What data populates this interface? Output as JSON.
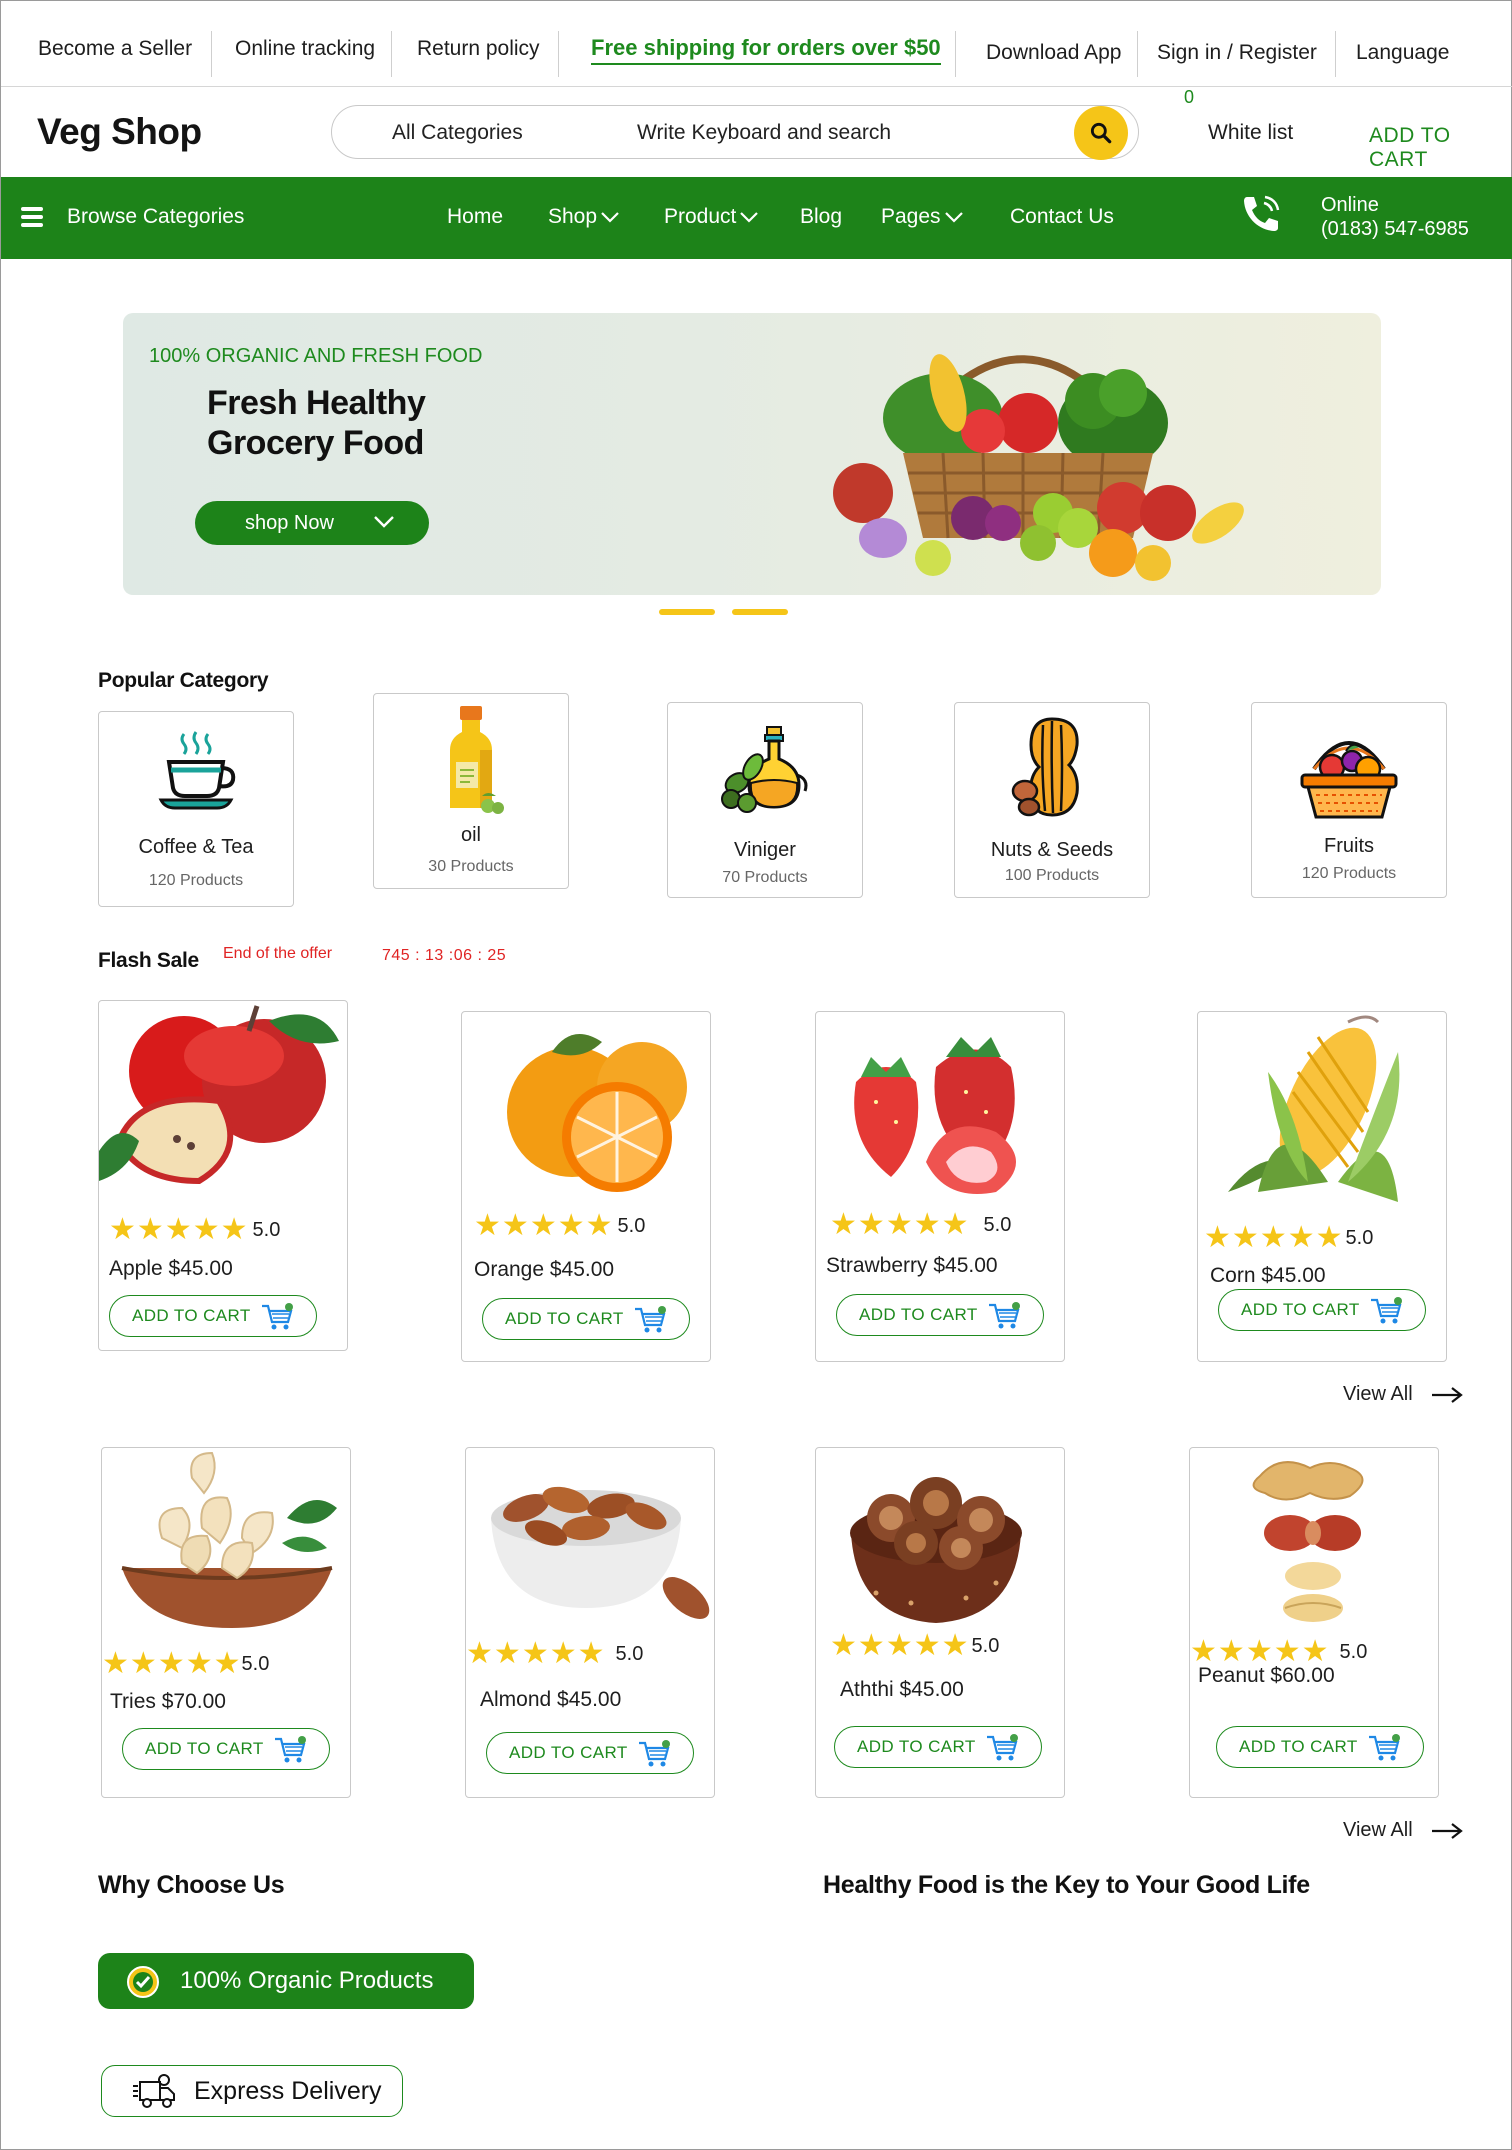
{
  "topbar": {
    "become_seller": "Become a Seller",
    "online_tracking": "Online tracking",
    "return_policy": "Return policy",
    "promo": "Free shipping for orders over $50",
    "download_app": "Download App",
    "sign_in": "Sign in / Register",
    "language": "Language"
  },
  "header": {
    "logo": "Veg Shop",
    "search_category": "All Categories",
    "search_placeholder": "Write Keyboard and search",
    "wishlist_count": "0",
    "wishlist": "White list",
    "add_to_cart": "ADD TO CART"
  },
  "nav": {
    "browse": "Browse Categories",
    "items": [
      "Home",
      "Shop",
      "Product",
      "Blog",
      "Pages",
      "Contact Us"
    ],
    "online_label": "Online",
    "phone": "(0183) 547-6985"
  },
  "hero": {
    "eyebrow": "100% ORGANIC AND FRESH FOOD",
    "title_line1": "Fresh Healthy",
    "title_line2": "Grocery Food",
    "button": "shop Now"
  },
  "popular": {
    "title": "Popular Category",
    "items": [
      {
        "name": "Coffee & Tea",
        "count": "120 Products"
      },
      {
        "name": "oil",
        "count": "30 Products"
      },
      {
        "name": "Viniger",
        "count": "70 Products"
      },
      {
        "name": "Nuts & Seeds",
        "count": "100 Products"
      },
      {
        "name": "Fruits",
        "count": "120 Products"
      }
    ]
  },
  "flash": {
    "title": "Flash Sale",
    "end_label": "End of the offer",
    "timer": "745 : 13 :06 : 25",
    "products": [
      {
        "name": "Apple $45.00",
        "rating": "5.0",
        "cta": "ADD TO CART"
      },
      {
        "name": "Orange $45.00",
        "rating": "5.0",
        "cta": "ADD TO CART"
      },
      {
        "name": "Strawberry $45.00",
        "rating": "5.0",
        "cta": "ADD TO CART"
      },
      {
        "name": "Corn $45.00",
        "rating": "5.0",
        "cta": "ADD TO CART"
      }
    ],
    "view_all": "View All"
  },
  "nuts": {
    "products": [
      {
        "name": "Tries $70.00",
        "rating": "5.0",
        "cta": "ADD TO CART"
      },
      {
        "name": "Almond $45.00",
        "rating": "5.0",
        "cta": "ADD TO CART"
      },
      {
        "name": "Aththi $45.00",
        "rating": "5.0",
        "cta": "ADD TO CART"
      },
      {
        "name": "Peanut $60.00",
        "rating": "5.0",
        "cta": "ADD TO CART"
      }
    ],
    "view_all": "View All"
  },
  "why": {
    "title": "Why Choose Us",
    "tagline": "Healthy Food is the Key to Your Good Life",
    "features": [
      "100% Organic Products",
      "Express Delivery"
    ]
  },
  "colors": {
    "brand_green": "#1d8319",
    "accent_yellow": "#f5c518",
    "alert_red": "#e02424"
  }
}
